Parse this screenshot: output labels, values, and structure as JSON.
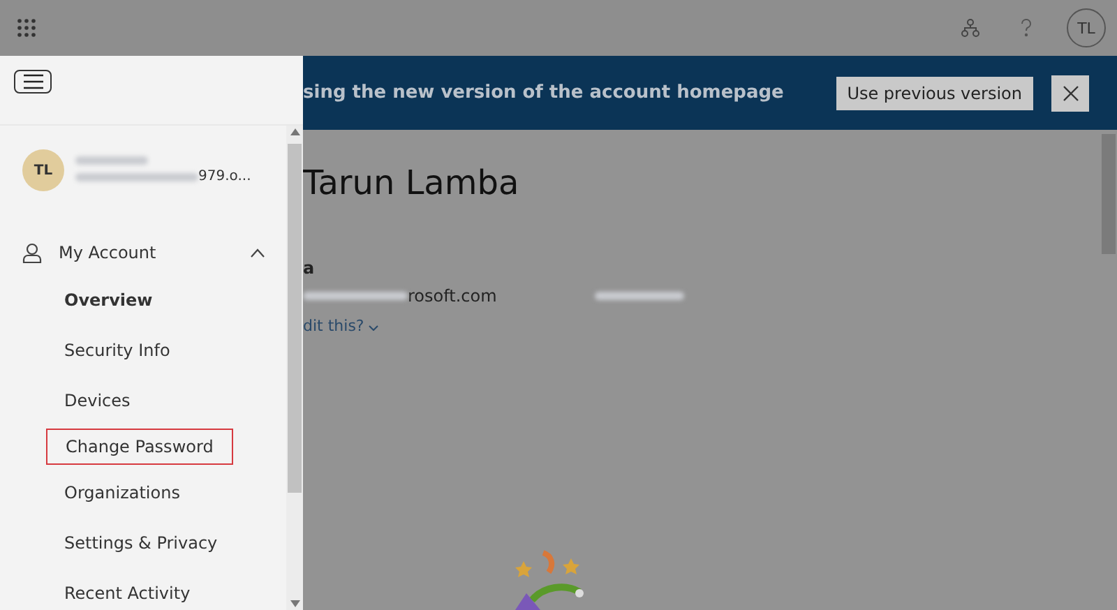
{
  "top_bar": {
    "avatar_initials": "TL"
  },
  "sidebar": {
    "profile": {
      "initials": "TL",
      "email_tail": "979.o..."
    },
    "section": {
      "label": "My Account",
      "expanded": true
    },
    "items": [
      {
        "label": "Overview",
        "selected": true,
        "highlighted": false
      },
      {
        "label": "Security Info",
        "selected": false,
        "highlighted": false
      },
      {
        "label": "Devices",
        "selected": false,
        "highlighted": false
      },
      {
        "label": "Change Password",
        "selected": false,
        "highlighted": true
      },
      {
        "label": "Organizations",
        "selected": false,
        "highlighted": false
      },
      {
        "label": "Settings & Privacy",
        "selected": false,
        "highlighted": false
      },
      {
        "label": "Recent Activity",
        "selected": false,
        "highlighted": false
      }
    ]
  },
  "banner": {
    "message": "sing the new version of the account homepage",
    "button": "Use previous version"
  },
  "profile_card": {
    "name": "Tarun Lamba",
    "label_tail": "a",
    "email_tail": "rosoft.com",
    "link": "dit this?"
  }
}
